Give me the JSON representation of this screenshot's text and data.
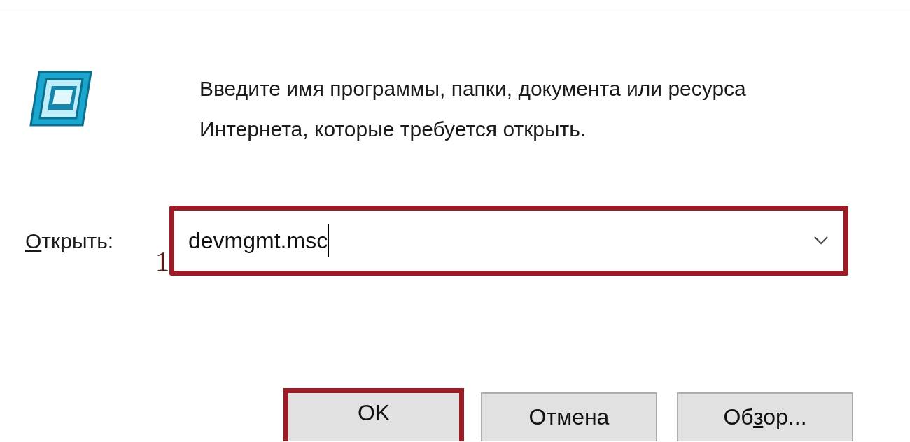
{
  "prompt": [
    "Введите имя программы, папки, документа или ресурса",
    "Интернета, которые требуется открыть."
  ],
  "open_label": {
    "access_key": "О",
    "after": "ткрыть:"
  },
  "annotation": "1",
  "command_field": {
    "value": "devmgmt.msc",
    "highlighted": true
  },
  "buttons": [
    {
      "after": "OK",
      "highlighted": true
    },
    {
      "after": "Отмена",
      "highlighted": false
    },
    {
      "before": "Об",
      "access_key": "з",
      "after": "ор...",
      "highlighted": false
    }
  ]
}
